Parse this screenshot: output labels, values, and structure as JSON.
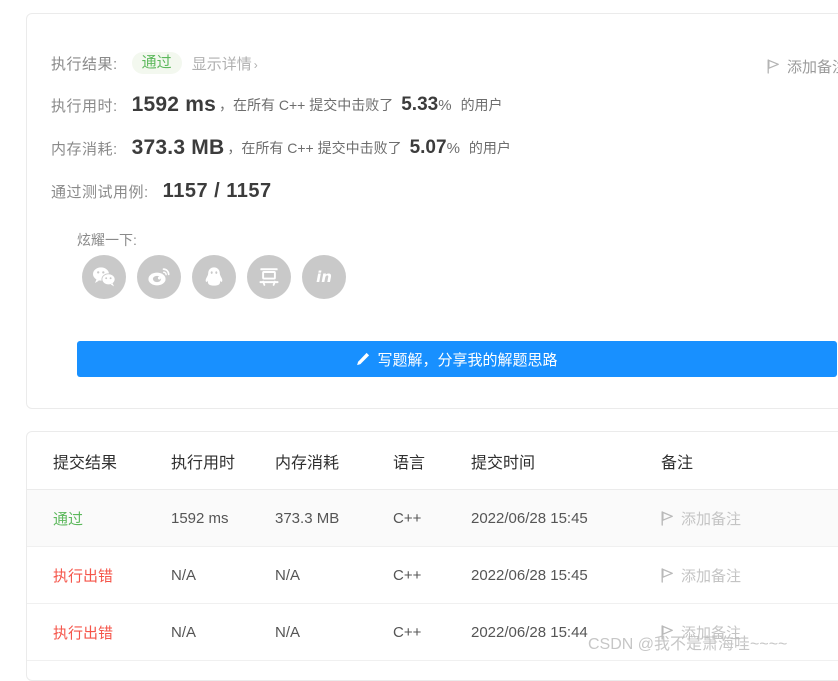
{
  "result_panel": {
    "result_label": "执行结果:",
    "result_badge": "通过",
    "detail_link": "显示详情",
    "detail_chevron": "›",
    "runtime_label": "执行用时:",
    "runtime_value": "1592 ms",
    "runtime_mid": "，在所有 C++ 提交中击败了",
    "runtime_percent": "5.33",
    "percent_sign": "%",
    "runtime_suffix": "的用户",
    "memory_label": "内存消耗:",
    "memory_value": "373.3 MB",
    "memory_mid": "，在所有 C++ 提交中击败了",
    "memory_percent": "5.07",
    "memory_suffix": "的用户",
    "cases_label": "通过测试用例:",
    "cases_value": "1157 / 1157",
    "add_note": "添加备注",
    "share_label": "炫耀一下:",
    "share_items": [
      {
        "name": "wechat-share-icon",
        "title": "微信"
      },
      {
        "name": "weibo-share-icon",
        "title": "微博"
      },
      {
        "name": "qq-share-icon",
        "title": "QQ"
      },
      {
        "name": "douban-share-icon",
        "title": "豆瓣",
        "glyph": "豆"
      },
      {
        "name": "linkedin-share-icon",
        "title": "LinkedIn",
        "glyph": "in"
      }
    ],
    "write_solution_button": "写题解，分享我的解题思路"
  },
  "submissions": {
    "columns": [
      "提交结果",
      "执行用时",
      "内存消耗",
      "语言",
      "提交时间",
      "备注"
    ],
    "rows": [
      {
        "status": "通过",
        "status_kind": "pass",
        "runtime": "1592 ms",
        "memory": "373.3 MB",
        "language": "C++",
        "time": "2022/06/28 15:45",
        "note": "添加备注"
      },
      {
        "status": "执行出错",
        "status_kind": "error",
        "runtime": "N/A",
        "memory": "N/A",
        "language": "C++",
        "time": "2022/06/28 15:45",
        "note": "添加备注"
      },
      {
        "status": "执行出错",
        "status_kind": "error",
        "runtime": "N/A",
        "memory": "N/A",
        "language": "C++",
        "time": "2022/06/28 15:44",
        "note": "添加备注"
      }
    ]
  },
  "watermark": "CSDN @我不是萧海哇~~~~",
  "colors": {
    "accent_blue": "#1890ff",
    "pass_green": "#5cb85c",
    "error_red": "#f5554a",
    "badge_bg": "#f3f8ef",
    "muted": "#8a8a8a"
  }
}
